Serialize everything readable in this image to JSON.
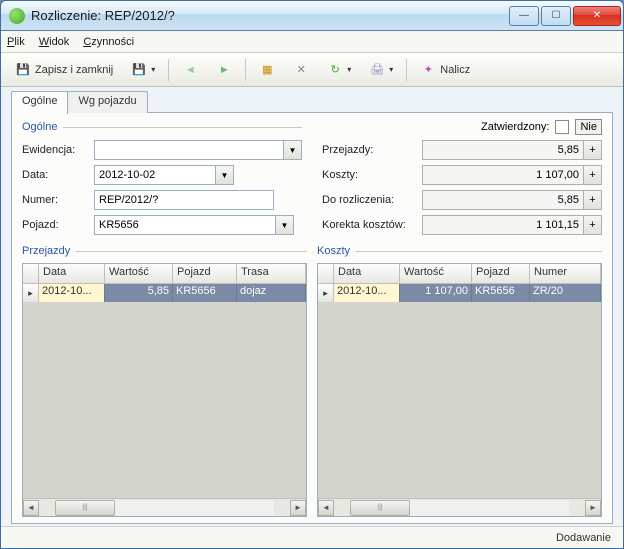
{
  "window": {
    "title": "Rozliczenie: REP/2012/?"
  },
  "menu": {
    "file": "Plik",
    "view": "Widok",
    "actions": "Czynności"
  },
  "toolbar": {
    "save_close": "Zapisz i zamknij",
    "calc": "Nalicz"
  },
  "tabs": {
    "general": "Ogólne",
    "by_vehicle": "Wg pojazdu"
  },
  "section": {
    "general": "Ogólne",
    "trips": "Przejazdy",
    "costs": "Koszty"
  },
  "form": {
    "ewidencja_label": "Ewidencja:",
    "ewidencja_value": "",
    "data_label": "Data:",
    "data_value": "2012-10-02",
    "numer_label": "Numer:",
    "numer_value": "REP/2012/?",
    "pojazd_label": "Pojazd:",
    "pojazd_value": "KR5656"
  },
  "confirmed": {
    "label": "Zatwierdzony:",
    "text": "Nie"
  },
  "summary": {
    "przejazdy_label": "Przejazdy:",
    "przejazdy_value": "5,85",
    "koszty_label": "Koszty:",
    "koszty_value": "1 107,00",
    "dorozl_label": "Do rozliczenia:",
    "dorozl_value": "5,85",
    "korekta_label": "Korekta kosztów:",
    "korekta_value": "1 101,15"
  },
  "grid_trips": {
    "cols": {
      "data": "Data",
      "wartosc": "Wartość",
      "pojazd": "Pojazd",
      "trasa": "Trasa"
    },
    "row": {
      "data": "2012-10...",
      "wartosc": "5,85",
      "pojazd": "KR5656",
      "trasa": "dojaz"
    }
  },
  "grid_costs": {
    "cols": {
      "data": "Data",
      "wartosc": "Wartość",
      "pojazd": "Pojazd",
      "numer": "Numer"
    },
    "row": {
      "data": "2012-10...",
      "wartosc": "1 107,00",
      "pojazd": "KR5656",
      "numer": "ZR/20"
    }
  },
  "status": {
    "text": "Dodawanie"
  }
}
